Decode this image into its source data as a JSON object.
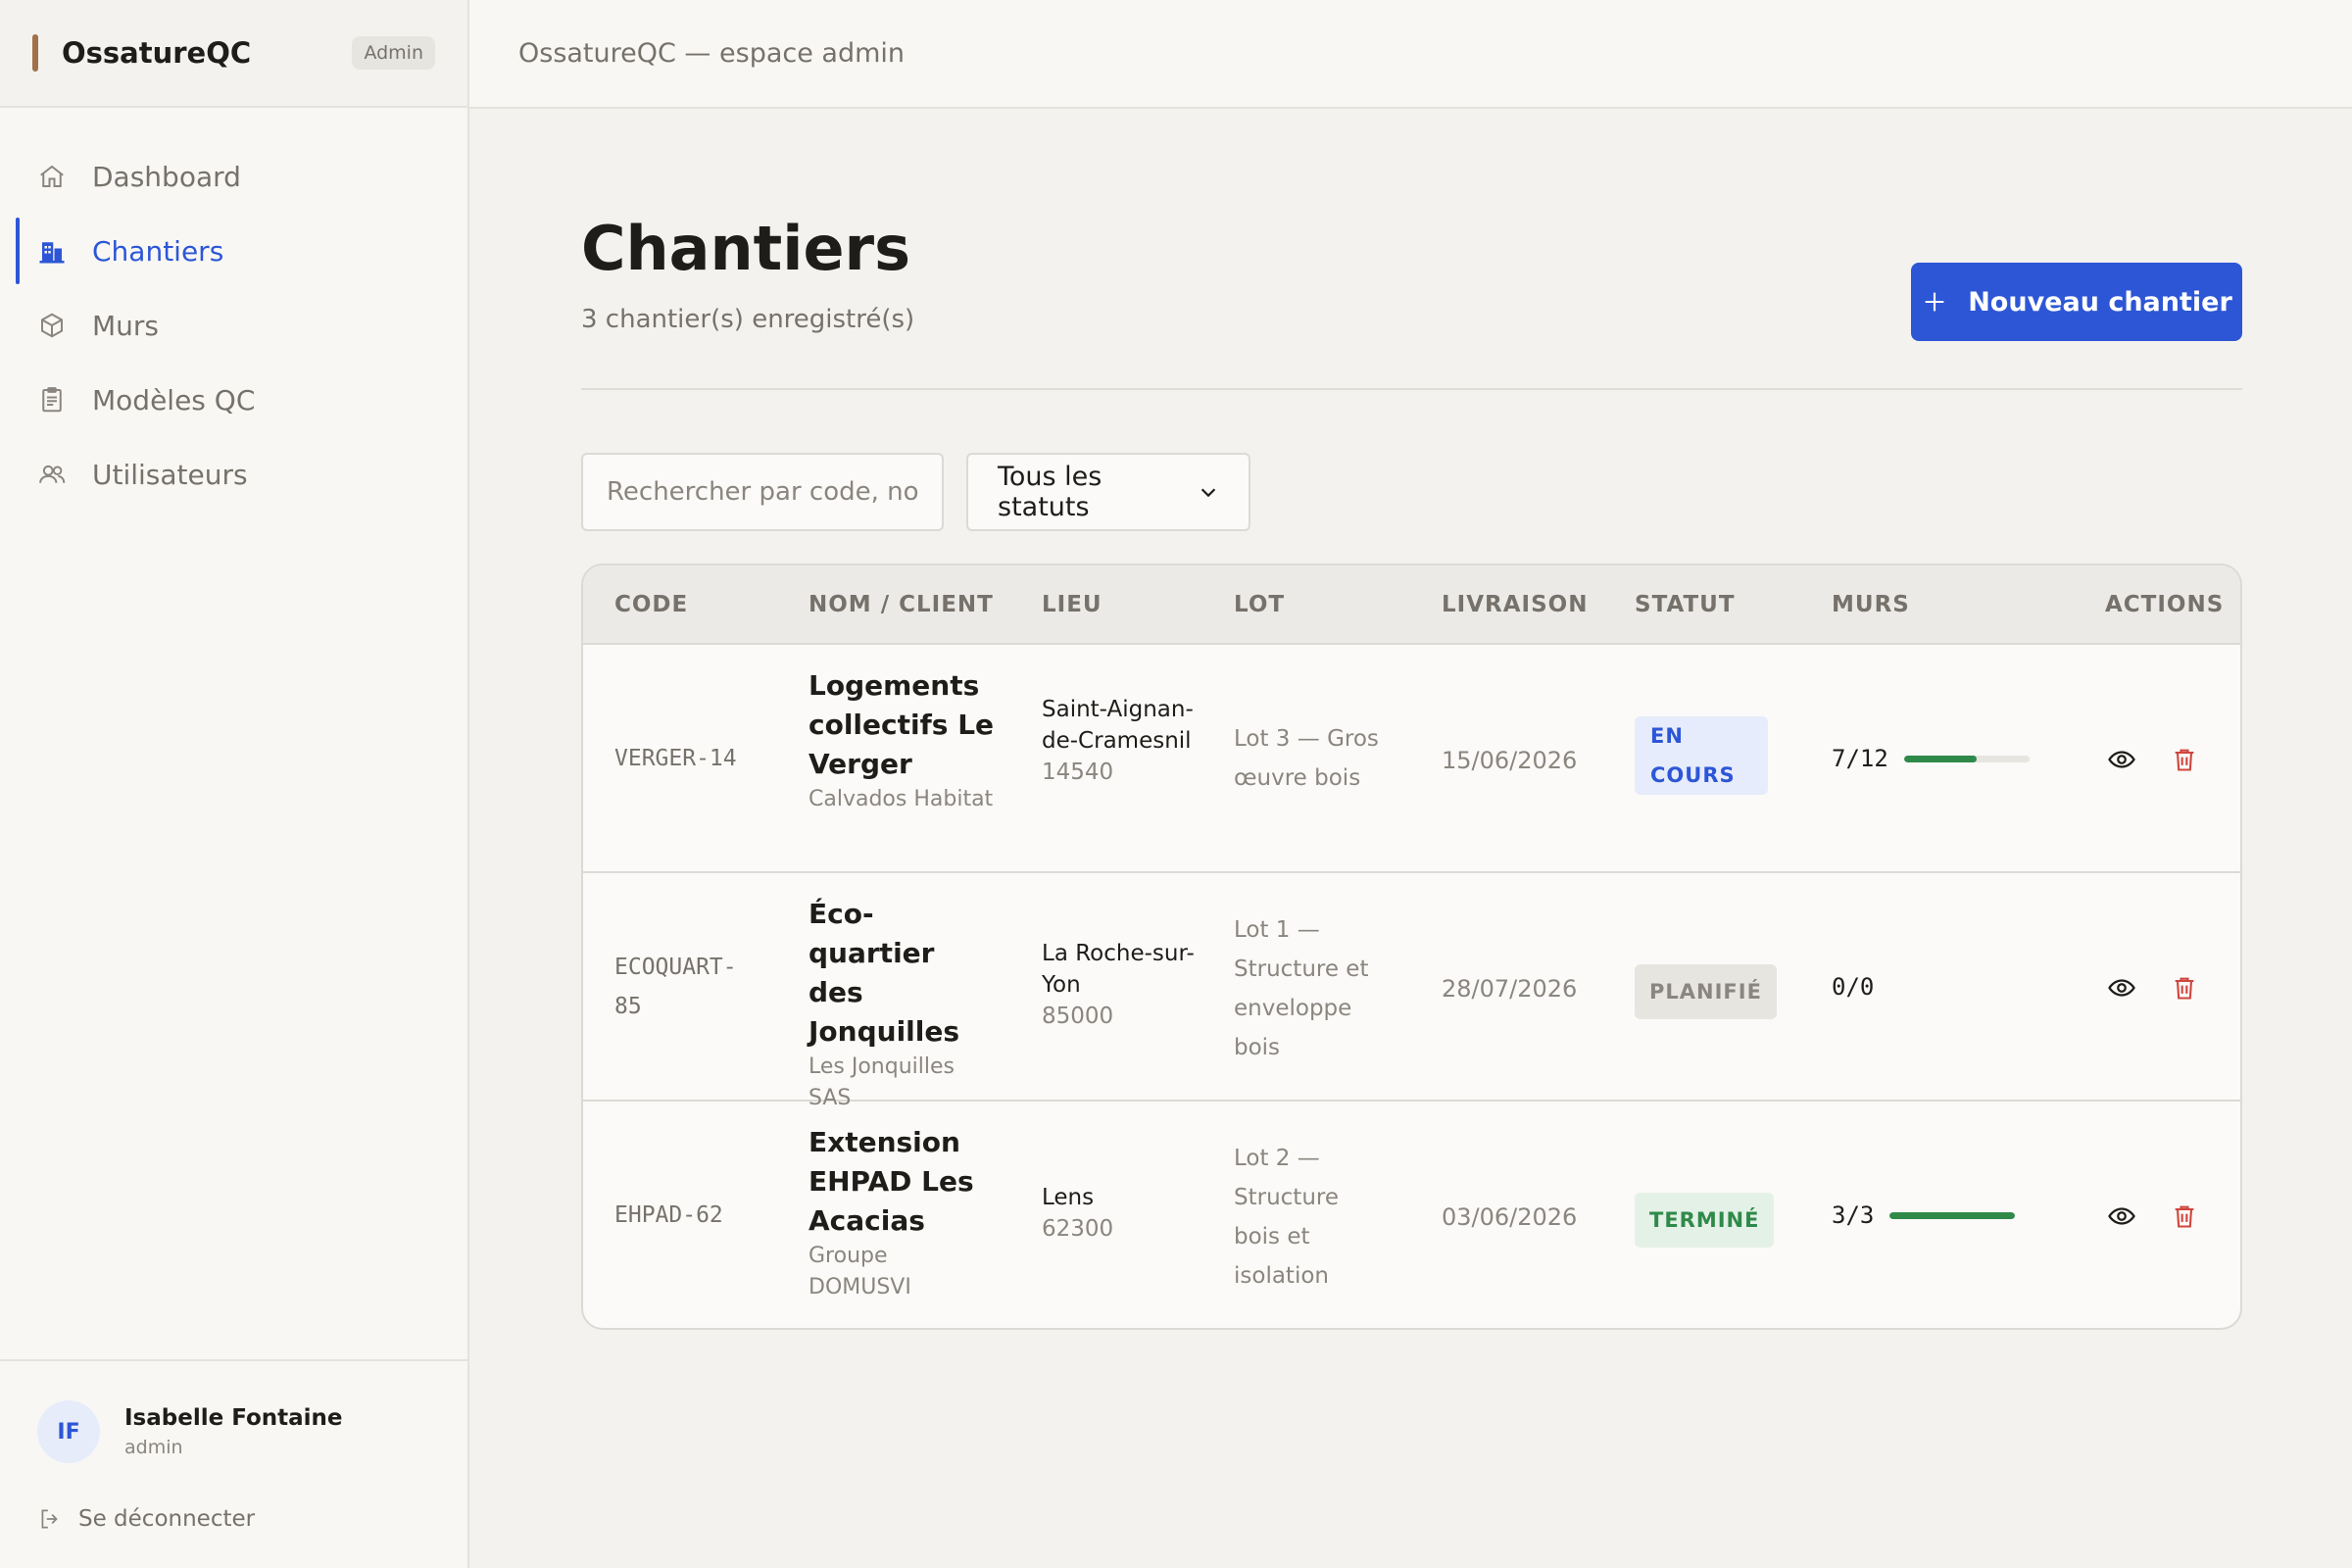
{
  "brand": {
    "name": "OssatureQC",
    "badge": "Admin"
  },
  "nav": {
    "items": [
      {
        "label": "Dashboard",
        "icon": "home-icon"
      },
      {
        "label": "Chantiers",
        "icon": "building-icon",
        "active": true
      },
      {
        "label": "Murs",
        "icon": "cube-icon"
      },
      {
        "label": "Modèles QC",
        "icon": "clipboard-icon"
      },
      {
        "label": "Utilisateurs",
        "icon": "users-icon"
      }
    ]
  },
  "user": {
    "initials": "IF",
    "name": "Isabelle Fontaine",
    "role": "admin",
    "logout_label": "Se déconnecter"
  },
  "topbar": {
    "title": "OssatureQC — espace admin"
  },
  "page": {
    "title": "Chantiers",
    "subtitle": "3 chantier(s) enregistré(s)",
    "new_button": "Nouveau chantier"
  },
  "filters": {
    "search_placeholder": "Rechercher par code, nom...",
    "status_selected": "Tous les statuts"
  },
  "table": {
    "headers": [
      "CODE",
      "NOM / CLIENT",
      "LIEU",
      "LOT",
      "LIVRAISON",
      "STATUT",
      "MURS",
      "ACTIONS"
    ],
    "rows": [
      {
        "code": "VERGER-14",
        "name": "Logements collectifs Le Verger",
        "client": "Calvados Habitat",
        "city": "Saint-Aignan-de-Cramesnil",
        "postal": "14540",
        "lot": "Lot 3 — Gros œuvre bois",
        "delivery": "15/06/2026",
        "status": "EN COURS",
        "murs": "7/12",
        "progress": 0.583
      },
      {
        "code": "ECOQUART-85",
        "name": "Éco-quartier des Jonquilles",
        "client": "Les Jonquilles SAS",
        "city": "La Roche-sur-Yon",
        "postal": "85000",
        "lot": "Lot 1 — Structure et enveloppe bois",
        "delivery": "28/07/2026",
        "status": "PLANIFIÉ",
        "murs": "0/0",
        "progress": null
      },
      {
        "code": "EHPAD-62",
        "name": "Extension EHPAD Les Acacias",
        "client": "Groupe DOMUSVI",
        "city": "Lens",
        "postal": "62300",
        "lot": "Lot 2 — Structure bois et isolation",
        "delivery": "03/06/2026",
        "status": "TERMINÉ",
        "murs": "3/3",
        "progress": 1.0
      }
    ]
  },
  "colors": {
    "accent": "#2d56d6",
    "brand": "#a0714a",
    "success": "#2f8a4a",
    "danger": "#d0453d"
  }
}
